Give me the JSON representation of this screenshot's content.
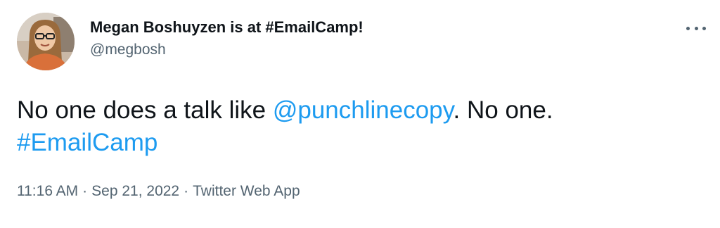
{
  "author": {
    "display_name": "Megan Boshuyzen is at #EmailCamp!",
    "handle": "@megbosh",
    "avatar_icon": "profile-photo"
  },
  "menu": {
    "icon": "more-options-icon"
  },
  "tweet": {
    "text_before_mention": "No one does a talk like ",
    "mention": "@punchlinecopy",
    "text_after_mention": ". No one.",
    "hashtag": "#EmailCamp"
  },
  "meta": {
    "time": "11:16 AM",
    "separator": "·",
    "date": "Sep 21, 2022",
    "source": "Twitter Web App"
  },
  "colors": {
    "link": "#1d9bf0",
    "secondary_text": "#536471",
    "primary_text": "#0f1419"
  }
}
